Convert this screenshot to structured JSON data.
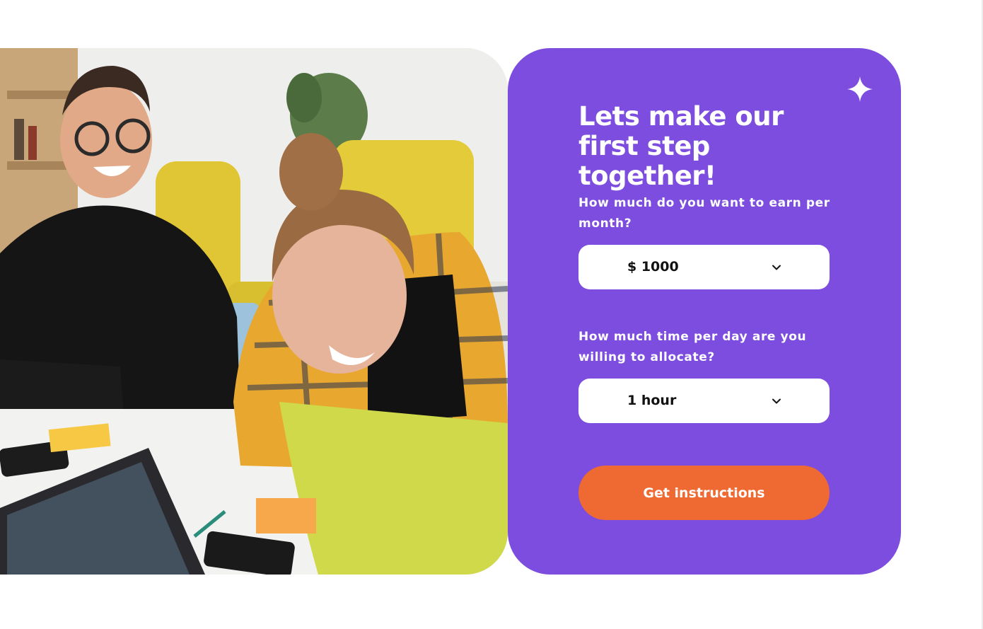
{
  "photo": {
    "alt": "Two people laughing at a table with laptops"
  },
  "form": {
    "headline": "Lets make our first step together!",
    "earn_label": "How much do you want to earn per month?",
    "earn_value": "$ 1000",
    "time_label": "How much time per day are you willing to allocate?",
    "time_value": "1 hour",
    "submit_label": "Get instructions"
  },
  "icons": {
    "sparkle": "sparkle-icon",
    "chevron": "chevron-down-icon"
  },
  "colors": {
    "card_background": "#7c4ddf",
    "button_background": "#ee6a32",
    "text_on_card": "#ffffff",
    "select_background": "#ffffff"
  }
}
